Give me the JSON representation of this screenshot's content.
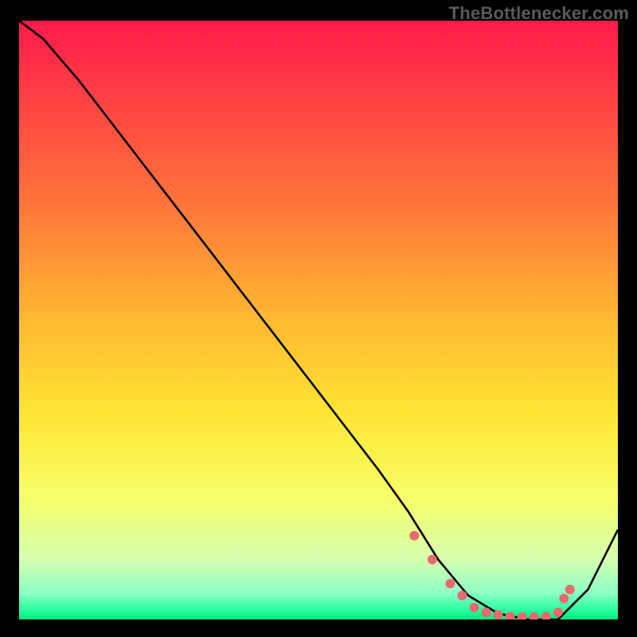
{
  "attribution": "TheBottlenecker.com",
  "chart_data": {
    "type": "line",
    "title": "",
    "xlabel": "",
    "ylabel": "",
    "xlim": [
      0,
      100
    ],
    "ylim": [
      0,
      100
    ],
    "gradient_stops": [
      {
        "offset": 0,
        "color": "#ff1a4b"
      },
      {
        "offset": 0.3,
        "color": "#ff733a"
      },
      {
        "offset": 0.5,
        "color": "#ffb931"
      },
      {
        "offset": 0.66,
        "color": "#ffe633"
      },
      {
        "offset": 0.8,
        "color": "#f6ff6a"
      },
      {
        "offset": 0.9,
        "color": "#d5ffb0"
      },
      {
        "offset": 0.955,
        "color": "#8effc6"
      },
      {
        "offset": 0.985,
        "color": "#28ff9e"
      },
      {
        "offset": 1.0,
        "color": "#00e67a"
      }
    ],
    "series": [
      {
        "name": "curve",
        "x": [
          0,
          4,
          10,
          20,
          30,
          40,
          50,
          60,
          65,
          70,
          75,
          80,
          85,
          90,
          95,
          100
        ],
        "y": [
          100,
          97,
          90,
          77,
          64,
          51,
          38,
          25,
          18,
          10,
          4,
          1,
          0,
          0,
          5,
          15
        ]
      }
    ],
    "markers": {
      "name": "dots",
      "x": [
        66,
        69,
        72,
        74,
        76,
        78,
        80,
        82,
        84,
        86,
        88,
        90,
        91,
        92
      ],
      "y": [
        14,
        10,
        6,
        4,
        2,
        1.2,
        0.8,
        0.5,
        0.4,
        0.4,
        0.5,
        1.2,
        3.5,
        5
      ],
      "color": "#e86a6f",
      "radius": 6
    }
  }
}
